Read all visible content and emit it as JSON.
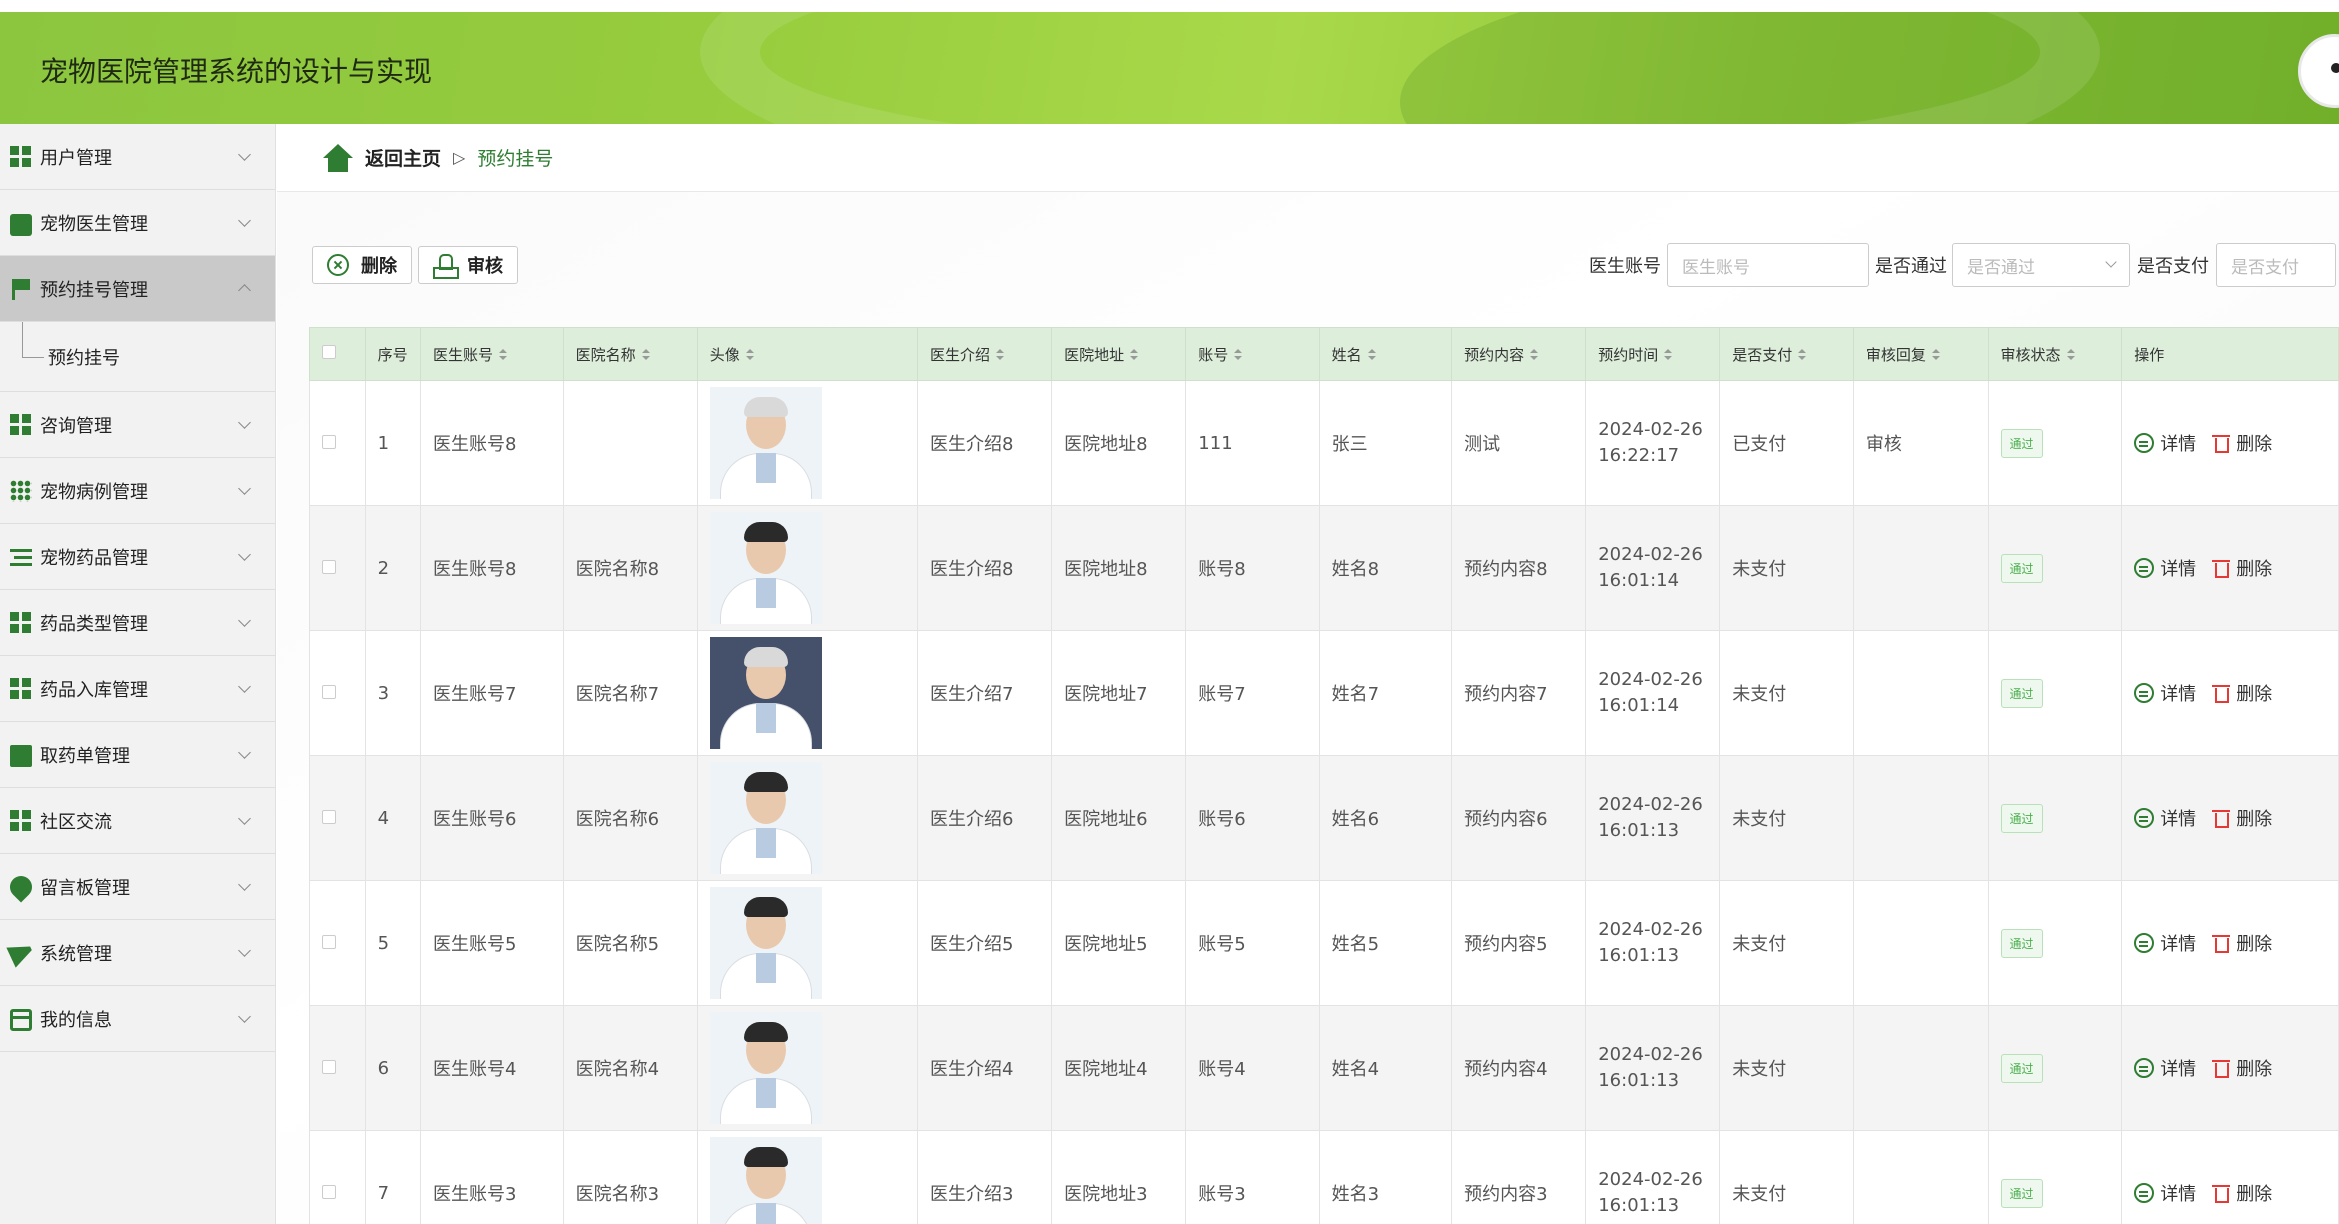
{
  "header": {
    "title": "宠物医院管理系统的设计与实现"
  },
  "sidebar": {
    "items": [
      {
        "label": "用户管理",
        "icon": "grid-icon"
      },
      {
        "label": "宠物医生管理",
        "icon": "box-icon"
      },
      {
        "label": "预约挂号管理",
        "icon": "flag-icon",
        "expanded": true
      },
      {
        "label": "咨询管理",
        "icon": "grid-icon"
      },
      {
        "label": "宠物病例管理",
        "icon": "dots-icon"
      },
      {
        "label": "宠物药品管理",
        "icon": "list-icon"
      },
      {
        "label": "药品类型管理",
        "icon": "grid-icon"
      },
      {
        "label": "药品入库管理",
        "icon": "grid-icon"
      },
      {
        "label": "取药单管理",
        "icon": "monitor-icon"
      },
      {
        "label": "社区交流",
        "icon": "grid-icon"
      },
      {
        "label": "留言板管理",
        "icon": "leaf-icon"
      },
      {
        "label": "系统管理",
        "icon": "plane-icon"
      },
      {
        "label": "我的信息",
        "icon": "card-icon"
      }
    ],
    "submenu": {
      "label": "预约挂号"
    }
  },
  "breadcrumb": {
    "home": "返回主页",
    "current": "预约挂号"
  },
  "toolbar": {
    "delete_label": "删除",
    "audit_label": "审核"
  },
  "filters": {
    "doctor_account": {
      "label": "医生账号",
      "placeholder": "医生账号"
    },
    "passed": {
      "label": "是否通过",
      "placeholder": "是否通过"
    },
    "paid": {
      "label": "是否支付",
      "placeholder": "是否支付"
    }
  },
  "table": {
    "columns": [
      "序号",
      "医生账号",
      "医院名称",
      "头像",
      "医生介绍",
      "医院地址",
      "账号",
      "姓名",
      "预约内容",
      "预约时间",
      "是否支付",
      "审核回复",
      "审核状态",
      "操作"
    ],
    "detail_label": "详情",
    "delete_label": "删除",
    "rows": [
      {
        "no": "1",
        "doctor_account": "医生账号8",
        "hospital": "",
        "intro": "医生介绍8",
        "address": "医院地址8",
        "account": "111",
        "name": "张三",
        "content": "测试",
        "date": "2024-02-26",
        "time": "16:22:17",
        "paid": "已支付",
        "reply": "审核",
        "status": "通过"
      },
      {
        "no": "2",
        "doctor_account": "医生账号8",
        "hospital": "医院名称8",
        "intro": "医生介绍8",
        "address": "医院地址8",
        "account": "账号8",
        "name": "姓名8",
        "content": "预约内容8",
        "date": "2024-02-26",
        "time": "16:01:14",
        "paid": "未支付",
        "reply": "",
        "status": "通过"
      },
      {
        "no": "3",
        "doctor_account": "医生账号7",
        "hospital": "医院名称7",
        "intro": "医生介绍7",
        "address": "医院地址7",
        "account": "账号7",
        "name": "姓名7",
        "content": "预约内容7",
        "date": "2024-02-26",
        "time": "16:01:14",
        "paid": "未支付",
        "reply": "",
        "status": "通过"
      },
      {
        "no": "4",
        "doctor_account": "医生账号6",
        "hospital": "医院名称6",
        "intro": "医生介绍6",
        "address": "医院地址6",
        "account": "账号6",
        "name": "姓名6",
        "content": "预约内容6",
        "date": "2024-02-26",
        "time": "16:01:13",
        "paid": "未支付",
        "reply": "",
        "status": "通过"
      },
      {
        "no": "5",
        "doctor_account": "医生账号5",
        "hospital": "医院名称5",
        "intro": "医生介绍5",
        "address": "医院地址5",
        "account": "账号5",
        "name": "姓名5",
        "content": "预约内容5",
        "date": "2024-02-26",
        "time": "16:01:13",
        "paid": "未支付",
        "reply": "",
        "status": "通过"
      },
      {
        "no": "6",
        "doctor_account": "医生账号4",
        "hospital": "医院名称4",
        "intro": "医生介绍4",
        "address": "医院地址4",
        "account": "账号4",
        "name": "姓名4",
        "content": "预约内容4",
        "date": "2024-02-26",
        "time": "16:01:13",
        "paid": "未支付",
        "reply": "",
        "status": "通过"
      },
      {
        "no": "7",
        "doctor_account": "医生账号3",
        "hospital": "医院名称3",
        "intro": "医生介绍3",
        "address": "医院地址3",
        "account": "账号3",
        "name": "姓名3",
        "content": "预约内容3",
        "date": "2024-02-26",
        "time": "16:01:13",
        "paid": "未支付",
        "reply": "",
        "status": "通过"
      }
    ]
  }
}
